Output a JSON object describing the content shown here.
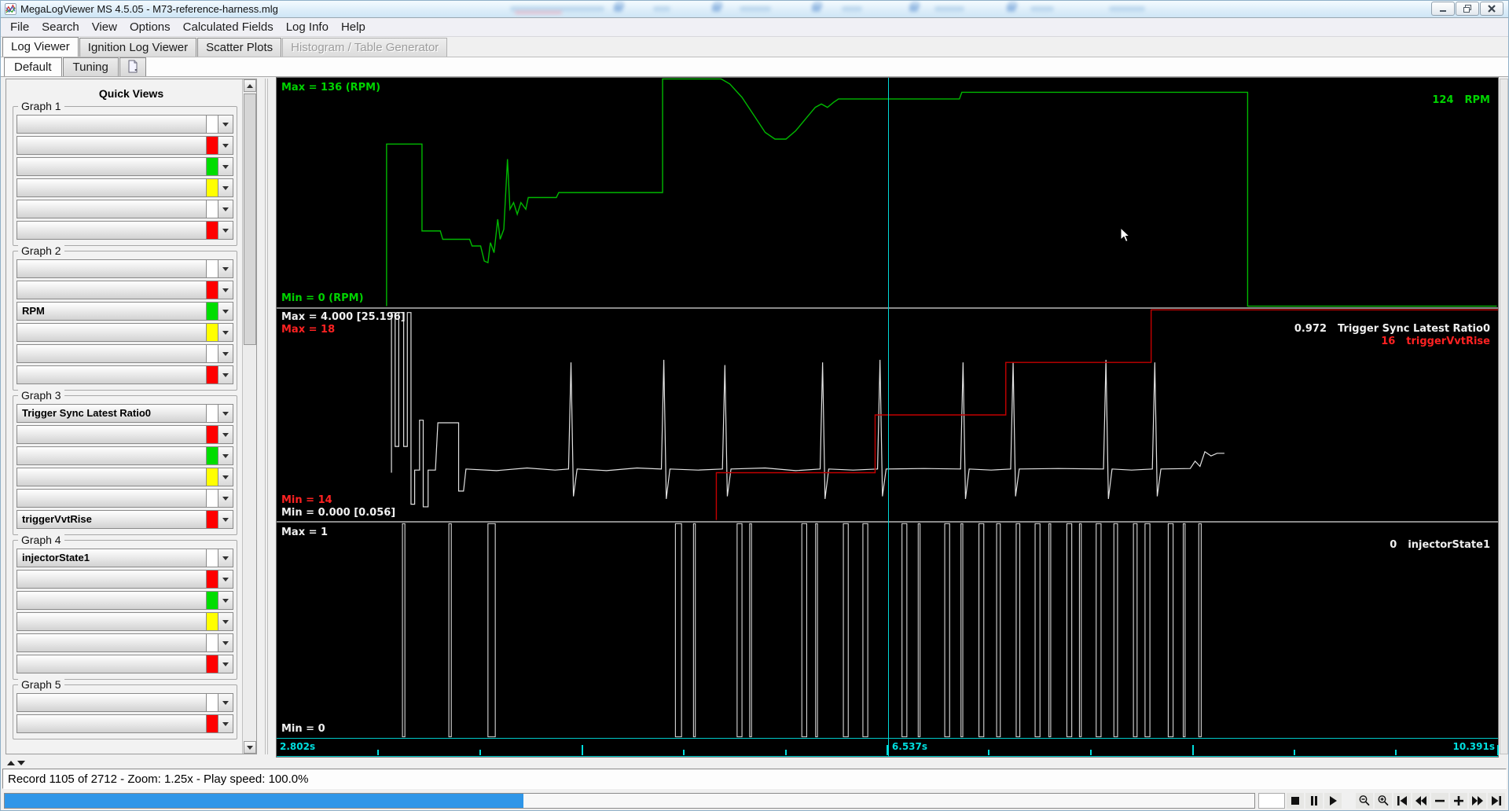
{
  "titlebar": {
    "title": "MegaLogViewer MS 4.5.05 - M73-reference-harness.mlg",
    "controls": {
      "minimize": "minimize",
      "restore": "restore",
      "close": "close"
    }
  },
  "menubar": {
    "items": [
      "File",
      "Search",
      "View",
      "Options",
      "Calculated Fields",
      "Log Info",
      "Help"
    ]
  },
  "main_tabs": {
    "items": [
      {
        "label": "Log Viewer",
        "state": "selected"
      },
      {
        "label": "Ignition Log Viewer",
        "state": "normal"
      },
      {
        "label": "Scatter Plots",
        "state": "normal"
      },
      {
        "label": "Histogram / Table Generator",
        "state": "disabled"
      }
    ]
  },
  "view_tabs": {
    "items": [
      {
        "label": "Default",
        "state": "selected"
      },
      {
        "label": "Tuning",
        "state": "normal"
      }
    ],
    "new_view_icon": "new-view-page-icon"
  },
  "sidebar": {
    "title": "Quick Views",
    "groups": [
      {
        "label": "Graph 1",
        "rows": [
          {
            "field": "",
            "color": "#ffffff"
          },
          {
            "field": "",
            "color": "#ff0000"
          },
          {
            "field": "",
            "color": "#00dd00"
          },
          {
            "field": "",
            "color": "#ffff00"
          },
          {
            "field": "",
            "color": "#ffffff"
          },
          {
            "field": "",
            "color": "#ff0000"
          }
        ]
      },
      {
        "label": "Graph 2",
        "rows": [
          {
            "field": "",
            "color": "#ffffff"
          },
          {
            "field": "",
            "color": "#ff0000"
          },
          {
            "field": "RPM",
            "color": "#00dd00"
          },
          {
            "field": "",
            "color": "#ffff00"
          },
          {
            "field": "",
            "color": "#ffffff"
          },
          {
            "field": "",
            "color": "#ff0000"
          }
        ]
      },
      {
        "label": "Graph 3",
        "rows": [
          {
            "field": "Trigger Sync Latest Ratio0",
            "color": "#ffffff"
          },
          {
            "field": "",
            "color": "#ff0000"
          },
          {
            "field": "",
            "color": "#00dd00"
          },
          {
            "field": "",
            "color": "#ffff00"
          },
          {
            "field": "",
            "color": "#ffffff"
          },
          {
            "field": "triggerVvtRise",
            "color": "#ff0000"
          }
        ]
      },
      {
        "label": "Graph 4",
        "rows": [
          {
            "field": "injectorState1",
            "color": "#ffffff"
          },
          {
            "field": "",
            "color": "#ff0000"
          },
          {
            "field": "",
            "color": "#00dd00"
          },
          {
            "field": "",
            "color": "#ffff00"
          },
          {
            "field": "",
            "color": "#ffffff"
          },
          {
            "field": "",
            "color": "#ff0000"
          }
        ]
      },
      {
        "label": "Graph 5",
        "rows": [
          {
            "field": "",
            "color": "#ffffff"
          },
          {
            "field": "",
            "color": "#ff0000"
          }
        ]
      }
    ]
  },
  "graphs": {
    "panel1": {
      "max_label": {
        "text": "Max = 136 (RPM)",
        "color": "#00d400"
      },
      "min_label": {
        "text": "Min = 0 (RPM)",
        "color": "#00d400"
      },
      "readout": {
        "value": "124",
        "name": "RPM",
        "color": "#00d400"
      }
    },
    "panel2": {
      "max_labels": [
        {
          "text": "Max = 4.000 [25.196]",
          "color": "#f0f0f0"
        },
        {
          "text": "Max = 18",
          "color": "#ff2222"
        }
      ],
      "min_labels": [
        {
          "text": "Min = 14",
          "color": "#ff2222"
        },
        {
          "text": "Min = 0.000 [0.056]",
          "color": "#f0f0f0"
        }
      ],
      "readouts": [
        {
          "value": "0.972",
          "name": "Trigger Sync Latest Ratio0",
          "color": "#f0f0f0"
        },
        {
          "value": "16",
          "name": "triggerVvtRise",
          "color": "#ff2222"
        }
      ]
    },
    "panel3": {
      "max_label": {
        "text": "Max = 1",
        "color": "#f0f0f0"
      },
      "min_label": {
        "text": "Min = 0",
        "color": "#f0f0f0"
      },
      "readout": {
        "value": "0",
        "name": "injectorState1",
        "color": "#f0f0f0"
      }
    }
  },
  "timeline": {
    "start_label": "2.802s",
    "cursor_label": "6.537s",
    "end_label": "10.391s",
    "color": "#00dede",
    "cursor_frac": 0.5006,
    "tick_count": 12,
    "tall_every": 3
  },
  "statusbar": {
    "text": "Record 1105 of 2712 - Zoom: 1.25x - Play speed: 100.0%"
  },
  "progress": {
    "fraction": 0.415,
    "color": "#2f96e8"
  },
  "transport": {
    "buttons": [
      {
        "id": "frame-box"
      },
      {
        "id": "stop"
      },
      {
        "id": "pause"
      },
      {
        "id": "play"
      },
      {
        "id": "spacer"
      },
      {
        "id": "zoom-out"
      },
      {
        "id": "zoom-in"
      },
      {
        "id": "skip-start"
      },
      {
        "id": "rewind"
      },
      {
        "id": "speed-minus"
      },
      {
        "id": "speed-plus"
      },
      {
        "id": "fast-forward"
      },
      {
        "id": "skip-end"
      }
    ]
  },
  "chart_data": [
    {
      "target": "g1",
      "type": "line",
      "name": "RPM",
      "color": "#00b800",
      "width": 1.4,
      "ylim": [
        0,
        136
      ],
      "points": [
        [
          0.09,
          0
        ],
        [
          0.09,
          97
        ],
        [
          0.119,
          97
        ],
        [
          0.119,
          45
        ],
        [
          0.134,
          45
        ],
        [
          0.136,
          40
        ],
        [
          0.158,
          40
        ],
        [
          0.16,
          36
        ],
        [
          0.167,
          36
        ],
        [
          0.17,
          27
        ],
        [
          0.173,
          26
        ],
        [
          0.175,
          38
        ],
        [
          0.178,
          32
        ],
        [
          0.181,
          52
        ],
        [
          0.183,
          40
        ],
        [
          0.186,
          46
        ],
        [
          0.189,
          88
        ],
        [
          0.191,
          58
        ],
        [
          0.194,
          62
        ],
        [
          0.197,
          55
        ],
        [
          0.2,
          62
        ],
        [
          0.204,
          58
        ],
        [
          0.206,
          65
        ],
        [
          0.229,
          65
        ],
        [
          0.231,
          68
        ],
        [
          0.316,
          68
        ],
        [
          0.316,
          136
        ],
        [
          0.364,
          136
        ],
        [
          0.371,
          133
        ],
        [
          0.381,
          125
        ],
        [
          0.391,
          114
        ],
        [
          0.4,
          104
        ],
        [
          0.408,
          100
        ],
        [
          0.417,
          100
        ],
        [
          0.425,
          105
        ],
        [
          0.433,
          112
        ],
        [
          0.441,
          119
        ],
        [
          0.446,
          121
        ],
        [
          0.451,
          119
        ],
        [
          0.456,
          122
        ],
        [
          0.46,
          124
        ],
        [
          0.559,
          124
        ],
        [
          0.561,
          128
        ],
        [
          0.795,
          128
        ],
        [
          0.795,
          0
        ],
        [
          0.999,
          0
        ]
      ]
    },
    {
      "target": "g2",
      "type": "line",
      "name": "Trigger Sync Latest Ratio0",
      "color": "#e2e2e2",
      "width": 1.2,
      "ylim": [
        0,
        4
      ],
      "points": [
        [
          0.094,
          0.9
        ],
        [
          0.094,
          3.95
        ],
        [
          0.097,
          3.95
        ],
        [
          0.097,
          1.4
        ],
        [
          0.1,
          1.4
        ],
        [
          0.1,
          3.95
        ],
        [
          0.104,
          3.95
        ],
        [
          0.104,
          1.4
        ],
        [
          0.107,
          1.4
        ],
        [
          0.107,
          3.95
        ],
        [
          0.11,
          3.95
        ],
        [
          0.11,
          0.3
        ],
        [
          0.113,
          0.3
        ],
        [
          0.113,
          0.95
        ],
        [
          0.117,
          0.95
        ],
        [
          0.117,
          1.9
        ],
        [
          0.12,
          1.9
        ],
        [
          0.12,
          0.25
        ],
        [
          0.124,
          0.25
        ],
        [
          0.124,
          0.95
        ],
        [
          0.13,
          0.95
        ],
        [
          0.132,
          1.85
        ],
        [
          0.149,
          1.85
        ],
        [
          0.149,
          0.55
        ],
        [
          0.153,
          0.55
        ],
        [
          0.155,
          0.97
        ],
        [
          0.18,
          0.94
        ],
        [
          0.205,
          0.99
        ],
        [
          0.228,
          0.95
        ],
        [
          0.239,
          0.97
        ],
        [
          0.241,
          3.0
        ],
        [
          0.243,
          0.45
        ],
        [
          0.246,
          0.97
        ],
        [
          0.27,
          0.94
        ],
        [
          0.295,
          0.99
        ],
        [
          0.315,
          0.97
        ],
        [
          0.317,
          3.05
        ],
        [
          0.319,
          0.4
        ],
        [
          0.322,
          0.97
        ],
        [
          0.345,
          0.95
        ],
        [
          0.365,
          0.97
        ],
        [
          0.367,
          2.95
        ],
        [
          0.369,
          0.45
        ],
        [
          0.372,
          0.97
        ],
        [
          0.4,
          0.99
        ],
        [
          0.425,
          0.94
        ],
        [
          0.445,
          0.97
        ],
        [
          0.447,
          3.0
        ],
        [
          0.449,
          0.4
        ],
        [
          0.452,
          0.97
        ],
        [
          0.472,
          0.95
        ],
        [
          0.492,
          0.97
        ],
        [
          0.494,
          3.05
        ],
        [
          0.496,
          0.45
        ],
        [
          0.499,
          0.97
        ],
        [
          0.53,
          0.98
        ],
        [
          0.56,
          0.97
        ],
        [
          0.562,
          3.0
        ],
        [
          0.564,
          0.4
        ],
        [
          0.567,
          0.97
        ],
        [
          0.585,
          0.95
        ],
        [
          0.601,
          0.97
        ],
        [
          0.603,
          3.0
        ],
        [
          0.605,
          0.45
        ],
        [
          0.608,
          0.97
        ],
        [
          0.64,
          0.98
        ],
        [
          0.677,
          0.97
        ],
        [
          0.679,
          3.05
        ],
        [
          0.681,
          0.4
        ],
        [
          0.684,
          0.97
        ],
        [
          0.7,
          0.95
        ],
        [
          0.717,
          0.97
        ],
        [
          0.719,
          3.0
        ],
        [
          0.721,
          0.45
        ],
        [
          0.724,
          0.97
        ],
        [
          0.748,
          0.98
        ],
        [
          0.752,
          1.12
        ],
        [
          0.756,
          1.02
        ],
        [
          0.76,
          1.3
        ],
        [
          0.765,
          1.22
        ],
        [
          0.77,
          1.27
        ],
        [
          0.776,
          1.27
        ]
      ]
    },
    {
      "target": "g2",
      "type": "line",
      "name": "triggerVvtRise",
      "color": "#c40000",
      "width": 1.4,
      "ylim": [
        14,
        18
      ],
      "points": [
        [
          0.36,
          14.0
        ],
        [
          0.36,
          14.9
        ],
        [
          0.49,
          14.9
        ],
        [
          0.49,
          16.0
        ],
        [
          0.597,
          16.0
        ],
        [
          0.597,
          17.0
        ],
        [
          0.716,
          17.0
        ],
        [
          0.716,
          18.0
        ],
        [
          1.0,
          18.0
        ]
      ]
    },
    {
      "target": "g3",
      "type": "pulses",
      "name": "injectorState1",
      "color": "#d8d8d8",
      "width": 1.1,
      "ylim": [
        0,
        1
      ],
      "pulses": [
        [
          0.104,
          0.002
        ],
        [
          0.142,
          0.002
        ],
        [
          0.176,
          0.006
        ],
        [
          0.329,
          0.005
        ],
        [
          0.342,
          0.0015
        ],
        [
          0.379,
          0.004
        ],
        [
          0.388,
          0.0015
        ],
        [
          0.432,
          0.004
        ],
        [
          0.442,
          0.0015
        ],
        [
          0.466,
          0.004
        ],
        [
          0.482,
          0.004
        ],
        [
          0.514,
          0.004
        ],
        [
          0.526,
          0.0015
        ],
        [
          0.549,
          0.004
        ],
        [
          0.561,
          0.0015
        ],
        [
          0.577,
          0.004
        ],
        [
          0.591,
          0.003
        ],
        [
          0.607,
          0.003
        ],
        [
          0.623,
          0.004
        ],
        [
          0.633,
          0.0015
        ],
        [
          0.649,
          0.004
        ],
        [
          0.658,
          0.0015
        ],
        [
          0.673,
          0.004
        ],
        [
          0.687,
          0.003
        ],
        [
          0.703,
          0.003
        ],
        [
          0.713,
          0.004
        ],
        [
          0.732,
          0.004
        ],
        [
          0.743,
          0.0015
        ],
        [
          0.756,
          0.002
        ]
      ]
    }
  ]
}
